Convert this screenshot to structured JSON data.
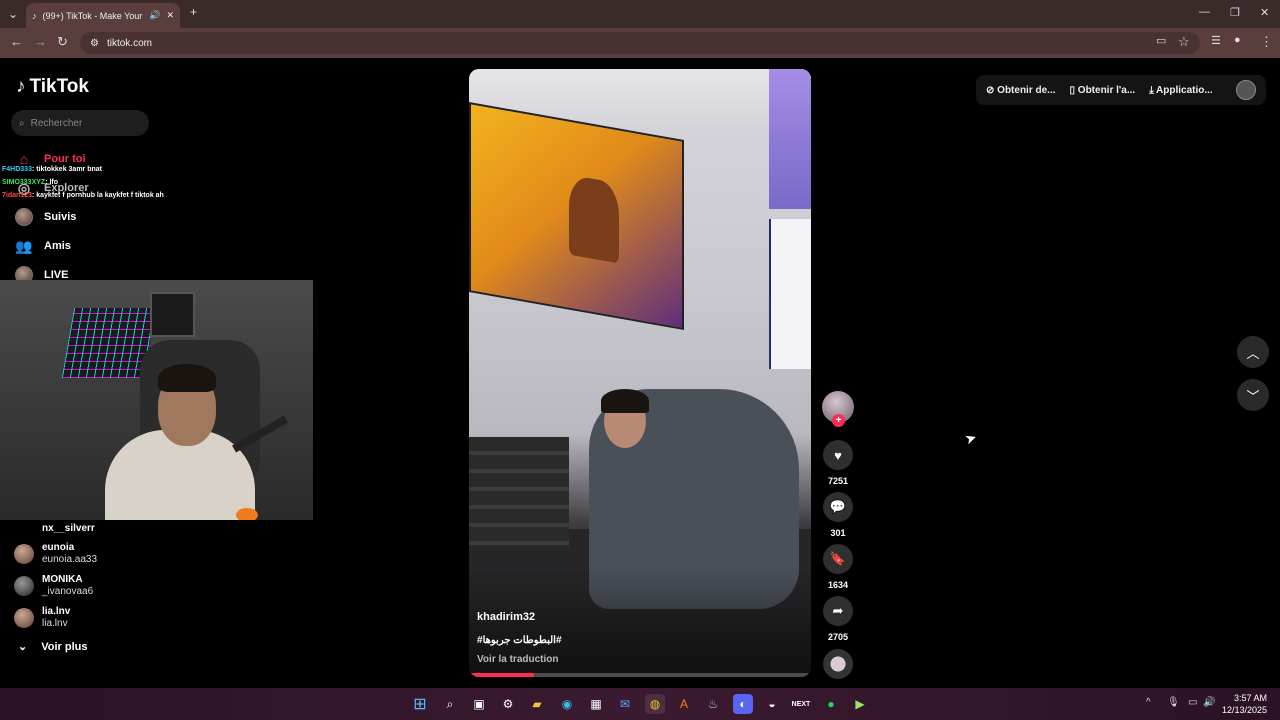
{
  "browser": {
    "tab_title": "(99+) TikTok - Make Your Da",
    "url": "tiktok.com"
  },
  "sidebar": {
    "logo": "TikTok",
    "search_placeholder": "Rechercher",
    "nav": {
      "pour_toi": "Pour toi",
      "explorer": "Explorer",
      "suivis": "Suivis",
      "amis": "Amis",
      "live": "LIVE"
    },
    "following": [
      {
        "name": "nx__silverr",
        "handle": ""
      },
      {
        "name": "eunoia",
        "handle": "eunoia.aa33"
      },
      {
        "name": "MONIKA",
        "handle": "_ivanovaa6"
      },
      {
        "name": "lia.lnv",
        "handle": "lia.lnv"
      }
    ],
    "voir_plus": "Voir plus"
  },
  "chat": [
    {
      "user": "F4HD333",
      "text": ": tiktokkek 3amr bnat",
      "color": "#3cc8ff"
    },
    {
      "user": "SIMO333XYZ",
      "text": ": lfo",
      "color": "#41e36b"
    },
    {
      "user": "7idan123",
      "text": ": kaykfet f pornhub la kaykfet f tiktok ah",
      "color": "#ff4a4a"
    }
  ],
  "video": {
    "author": "khadirim32",
    "description": "#البطوطات جربوها#",
    "translate": "Voir la traduction",
    "progress": 0.19
  },
  "actions": {
    "likes": "7251",
    "comments": "301",
    "saves": "1634",
    "shares": "2705"
  },
  "topbar": {
    "btn1": "Obtenir de...",
    "btn2": "Obtenir l'a...",
    "btn3": "Applicatio..."
  },
  "taskbar": {
    "time": "3:57 AM",
    "date": "12/13/2025"
  },
  "colors": {
    "accent": "#fe2c55"
  }
}
